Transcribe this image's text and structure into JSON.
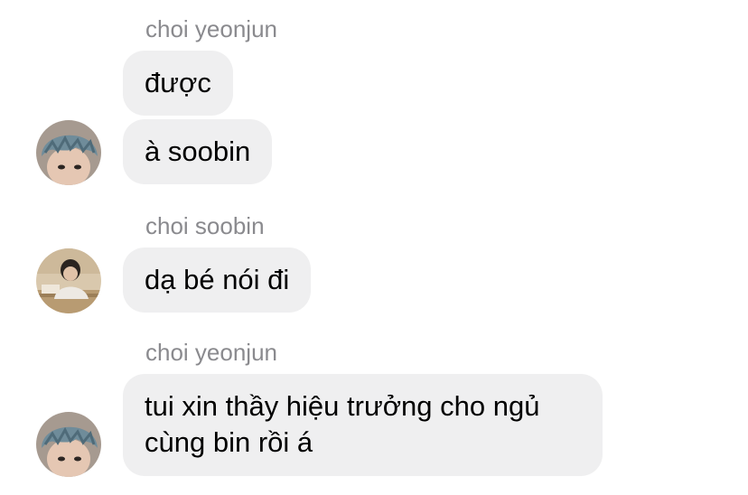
{
  "messages": [
    {
      "sender": "choi yeonjun",
      "bubbles": [
        "được",
        "à soobin"
      ],
      "avatar": "yeonjun-avatar"
    },
    {
      "sender": "choi soobin",
      "bubbles": [
        "dạ bé nói đi"
      ],
      "avatar": "soobin-avatar"
    },
    {
      "sender": "choi yeonjun",
      "bubbles": [
        "tui xin thầy hiệu trưởng cho ngủ cùng bin rồi á"
      ],
      "avatar": "yeonjun-avatar"
    }
  ],
  "colors": {
    "bubble_bg": "#efeff0",
    "sender_text": "#8a8a8e",
    "message_text": "#000000"
  }
}
